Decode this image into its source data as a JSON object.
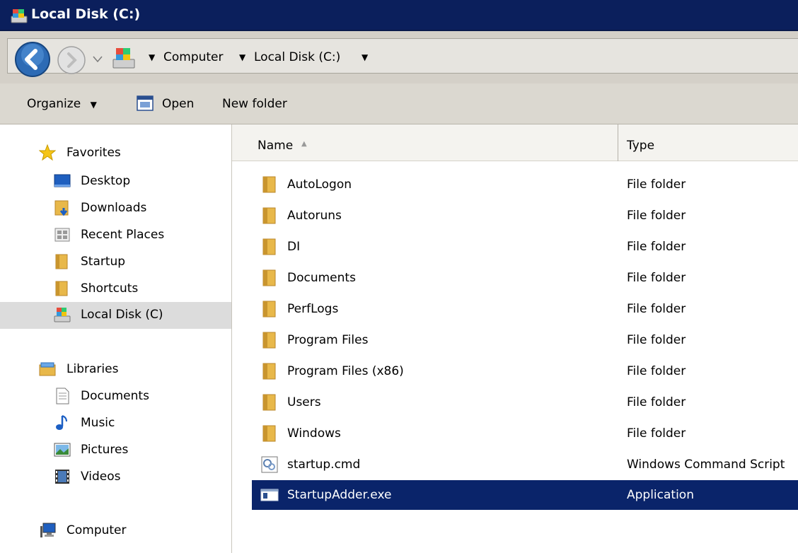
{
  "window": {
    "title": "Local Disk (C:)"
  },
  "address": {
    "breadcrumbs": [
      "Computer",
      "Local Disk (C:)"
    ]
  },
  "toolbar": {
    "organize": "Organize",
    "open": "Open",
    "new_folder": "New folder"
  },
  "nav": {
    "favorites": {
      "label": "Favorites",
      "items": [
        "Desktop",
        "Downloads",
        "Recent Places",
        "Startup",
        "Shortcuts",
        "Local Disk (C)"
      ]
    },
    "libraries": {
      "label": "Libraries",
      "items": [
        "Documents",
        "Music",
        "Pictures",
        "Videos"
      ]
    },
    "computer": {
      "label": "Computer"
    },
    "selected": "Local Disk (C)"
  },
  "columns": {
    "name": "Name",
    "type": "Type"
  },
  "files": [
    {
      "name": "AutoLogon",
      "type": "File folder",
      "icon": "folder-icon"
    },
    {
      "name": "Autoruns",
      "type": "File folder",
      "icon": "folder-icon"
    },
    {
      "name": "DI",
      "type": "File folder",
      "icon": "folder-icon"
    },
    {
      "name": "Documents",
      "type": "File folder",
      "icon": "folder-icon"
    },
    {
      "name": "PerfLogs",
      "type": "File folder",
      "icon": "folder-icon"
    },
    {
      "name": "Program Files",
      "type": "File folder",
      "icon": "folder-icon"
    },
    {
      "name": "Program Files (x86)",
      "type": "File folder",
      "icon": "folder-icon"
    },
    {
      "name": "Users",
      "type": "File folder",
      "icon": "folder-icon"
    },
    {
      "name": "Windows",
      "type": "File folder",
      "icon": "folder-icon"
    },
    {
      "name": "startup.cmd",
      "type": "Windows Command Script",
      "icon": "script-file-icon"
    },
    {
      "name": "StartupAdder.exe",
      "type": "Application",
      "icon": "application-icon"
    }
  ],
  "selected_file": "StartupAdder.exe",
  "colors": {
    "titlebar": "#0b1f5c",
    "selection": "#0a246a",
    "nav_selection": "#dcdcdc",
    "folder": "#e8b84a"
  }
}
